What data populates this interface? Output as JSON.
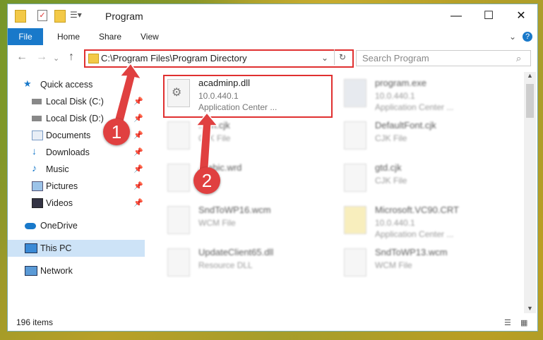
{
  "window": {
    "title": "Program",
    "minimize_icon": "minimize-icon",
    "maximize_icon": "maximize-icon",
    "close_icon": "close-icon"
  },
  "ribbon": {
    "tabs": [
      "File",
      "Home",
      "Share",
      "View"
    ],
    "accent": "#1979ca"
  },
  "nav": {
    "address": "C:\\Program Files\\Program Directory",
    "search_placeholder": "Search Program"
  },
  "sidebar": {
    "items": [
      {
        "label": "Quick access",
        "icon": "star-icon"
      },
      {
        "label": "Local Disk (C:)",
        "icon": "drive-icon"
      },
      {
        "label": "Local Disk (D:)",
        "icon": "drive-icon"
      },
      {
        "label": "Documents",
        "icon": "documents-icon"
      },
      {
        "label": "Downloads",
        "icon": "downloads-icon"
      },
      {
        "label": "Music",
        "icon": "music-icon"
      },
      {
        "label": "Pictures",
        "icon": "pictures-icon"
      },
      {
        "label": "Videos",
        "icon": "videos-icon"
      },
      {
        "label": "OneDrive",
        "icon": "cloud-icon"
      },
      {
        "label": "This PC",
        "icon": "computer-icon"
      },
      {
        "label": "Network",
        "icon": "network-icon"
      }
    ]
  },
  "files": [
    {
      "name": "acadminp.dll",
      "line2": "10.0.440.1",
      "line3": "Application Center ..."
    },
    {
      "name": "program.exe",
      "line2": "10.0.440.1",
      "line3": "Application Center ..."
    },
    {
      "name": "...an.cjk",
      "line2": "CJK File",
      "line3": ""
    },
    {
      "name": "DefaultFont.cjk",
      "line2": "CJK File",
      "line3": ""
    },
    {
      "name": "Arabic.wrd",
      "line2": "",
      "line3": ""
    },
    {
      "name": "gtd.cjk",
      "line2": "CJK File",
      "line3": ""
    },
    {
      "name": "SndToWP16.wcm",
      "line2": "WCM File",
      "line3": ""
    },
    {
      "name": "Microsoft.VC90.CRT",
      "line2": "10.0.440.1",
      "line3": "Application Center ..."
    },
    {
      "name": "UpdateClient65.dll",
      "line2": "Resource DLL",
      "line3": ""
    },
    {
      "name": "SndToWP13.wcm",
      "line2": "WCM File",
      "line3": ""
    }
  ],
  "status": {
    "items": "196 items"
  },
  "annotations": {
    "step1": "1",
    "step2": "2",
    "color": "#e04040"
  }
}
